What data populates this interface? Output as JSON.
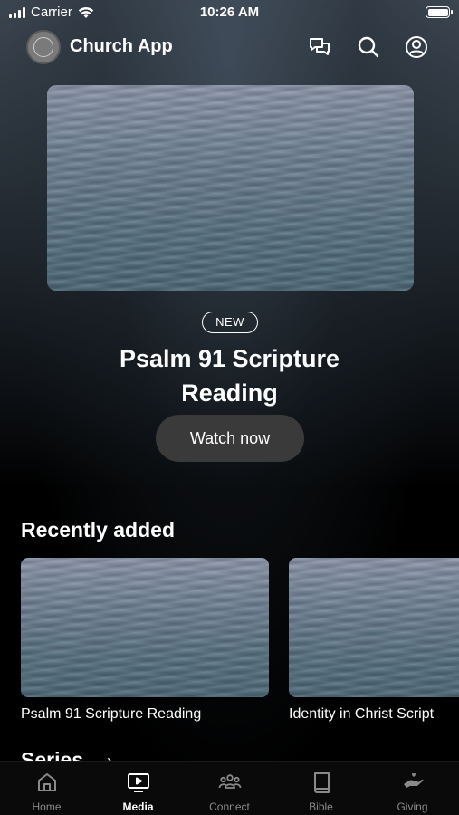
{
  "status_bar": {
    "carrier": "Carrier",
    "time": "10:26 AM"
  },
  "header": {
    "title": "Church App"
  },
  "hero": {
    "badge": "NEW",
    "title": "Psalm 91 Scripture Reading",
    "button_label": "Watch now"
  },
  "recently_added": {
    "title": "Recently added",
    "items": [
      {
        "label": "Psalm 91 Scripture Reading"
      },
      {
        "label": "Identity in Christ Script"
      }
    ]
  },
  "series": {
    "title": "Series",
    "chevron": "›"
  },
  "tabs": [
    {
      "label": "Home",
      "icon": "home-icon"
    },
    {
      "label": "Media",
      "icon": "tv-icon",
      "active": true
    },
    {
      "label": "Connect",
      "icon": "people-icon"
    },
    {
      "label": "Bible",
      "icon": "book-icon"
    },
    {
      "label": "Giving",
      "icon": "giving-hand-icon"
    }
  ]
}
